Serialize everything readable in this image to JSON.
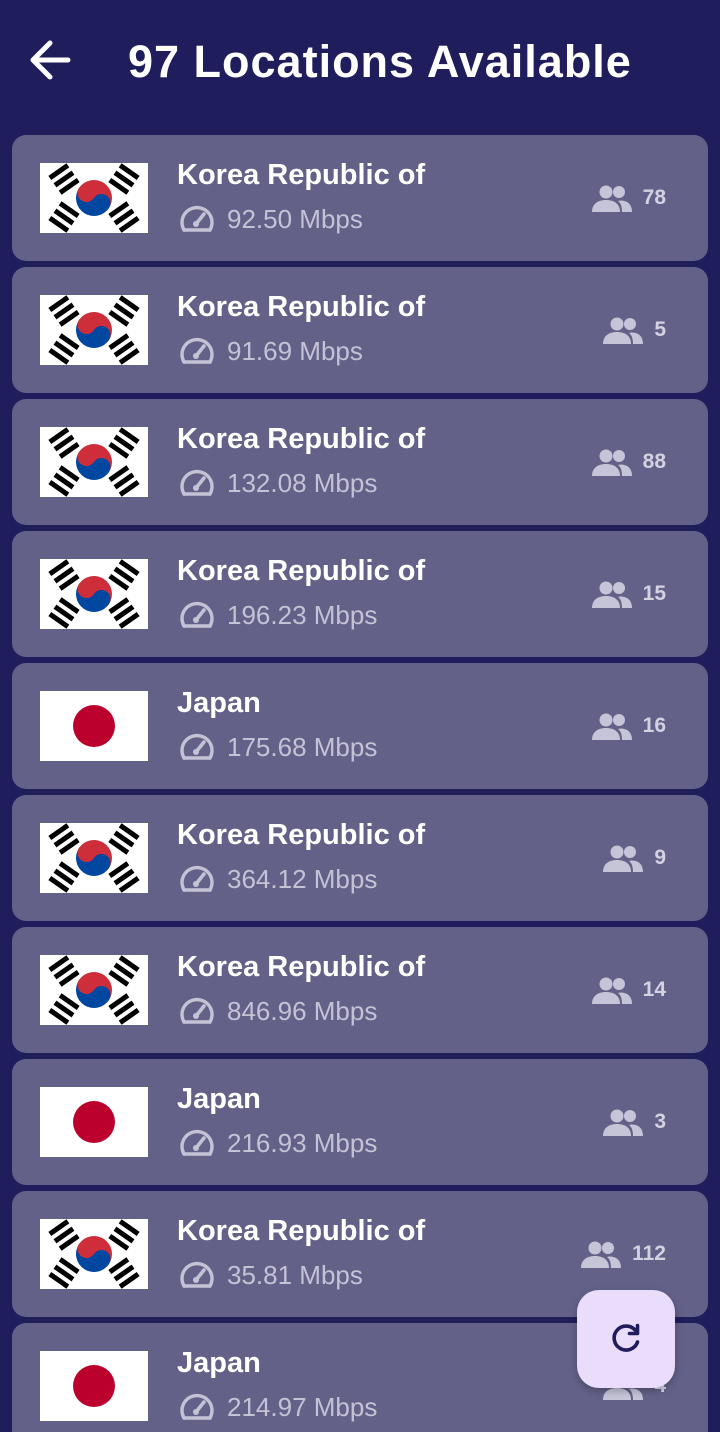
{
  "header": {
    "title": "97 Locations Available"
  },
  "colors": {
    "background": "#1f1d5b",
    "card": "#636188",
    "fab": "#eadcfb",
    "korea_red": "#cd2e3a",
    "korea_blue": "#0047a0",
    "japan_red": "#bc002d"
  },
  "servers": [
    {
      "country": "Korea Republic of",
      "flag": "korea-flag",
      "speed": "92.50 Mbps",
      "users": "78"
    },
    {
      "country": "Korea Republic of",
      "flag": "korea-flag",
      "speed": "91.69 Mbps",
      "users": "5"
    },
    {
      "country": "Korea Republic of",
      "flag": "korea-flag",
      "speed": "132.08 Mbps",
      "users": "88"
    },
    {
      "country": "Korea Republic of",
      "flag": "korea-flag",
      "speed": "196.23 Mbps",
      "users": "15"
    },
    {
      "country": "Japan",
      "flag": "japan-flag",
      "speed": "175.68 Mbps",
      "users": "16"
    },
    {
      "country": "Korea Republic of",
      "flag": "korea-flag",
      "speed": "364.12 Mbps",
      "users": "9"
    },
    {
      "country": "Korea Republic of",
      "flag": "korea-flag",
      "speed": "846.96 Mbps",
      "users": "14"
    },
    {
      "country": "Japan",
      "flag": "japan-flag",
      "speed": "216.93 Mbps",
      "users": "3"
    },
    {
      "country": "Korea Republic of",
      "flag": "korea-flag",
      "speed": "35.81 Mbps",
      "users": "112"
    },
    {
      "country": "Japan",
      "flag": "japan-flag",
      "speed": "214.97 Mbps",
      "users": "4"
    }
  ],
  "icons": {
    "back": "arrow-left-icon",
    "speed": "speedometer-icon",
    "users": "group-icon",
    "refresh": "refresh-icon"
  }
}
